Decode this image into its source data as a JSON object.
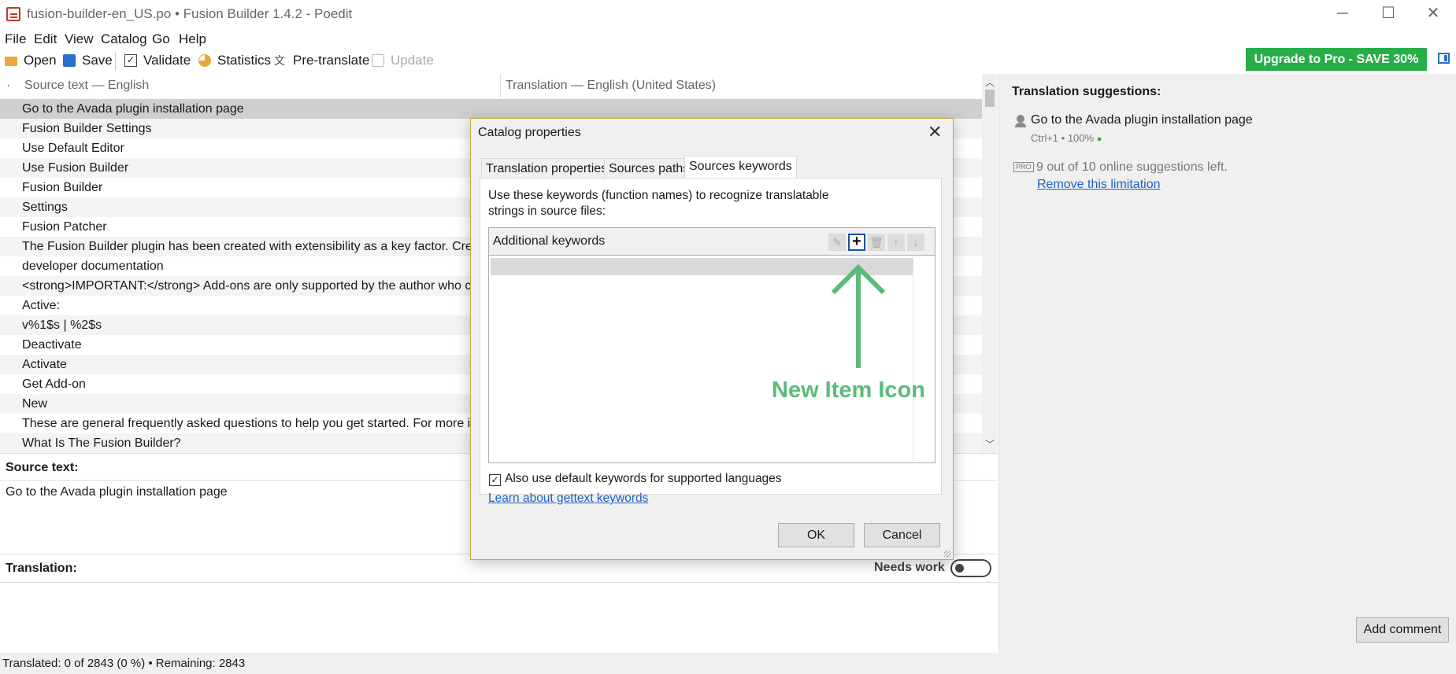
{
  "window": {
    "title": "fusion-builder-en_US.po • Fusion Builder 1.4.2 - Poedit",
    "minimize": "─",
    "maximize": "☐",
    "close": "✕"
  },
  "menu": [
    "File",
    "Edit",
    "View",
    "Catalog",
    "Go",
    "Help"
  ],
  "toolbar": {
    "open": "Open",
    "save": "Save",
    "validate": "Validate",
    "statistics": "Statistics",
    "pretranslate": "Pre-translate",
    "update": "Update",
    "upgrade": "Upgrade to Pro - SAVE 30%"
  },
  "list": {
    "dot": "·",
    "source_header": "Source text — English",
    "translation_header": "Translation — English (United States)",
    "rows": [
      "Go to the Avada plugin installation page",
      "Fusion Builder Settings",
      "Use Default Editor",
      "Use Fusion Builder",
      "Fusion Builder",
      "Settings",
      "Fusion Patcher",
      "The Fusion Builder plugin has been created with extensibility as a key factor. Creating A",
      "developer documentation",
      "<strong>IMPORTANT:</strong> Add-ons are only supported by the author who create",
      "Active:",
      "v%1$s | %2$s",
      "Deactivate",
      "Activate",
      "Get Add-on",
      "New",
      "These are general frequently asked questions to help you get started. For more in-dept",
      "What Is The Fusion Builder?"
    ]
  },
  "source_pane": {
    "label": "Source text:",
    "text": "Go to the Avada plugin installation page"
  },
  "translation_pane": {
    "label": "Translation:",
    "needs_work": "Needs work",
    "needs_work_on": false
  },
  "status": "Translated: 0 of 2843 (0 %)  •  Remaining: 2843",
  "sidebar": {
    "title": "Translation suggestions:",
    "suggestion": "Go to the Avada plugin installation page",
    "suggestion_meta": "Ctrl+1 • 100%",
    "pro_badge": "PRO",
    "suggestions_left": "9 out of 10 online suggestions left.",
    "remove_limit": "Remove this limitation",
    "add_comment": "Add comment"
  },
  "dialog": {
    "title": "Catalog properties",
    "close": "✕",
    "tabs": [
      "Translation properties",
      "Sources paths",
      "Sources keywords"
    ],
    "active_tab": 2,
    "intro": "Use these keywords (function names) to recognize translatable strings in source files:",
    "keywords_header": "Additional keywords",
    "tools": [
      "✎",
      "+",
      "🗑",
      "↑",
      "↓"
    ],
    "checkbox_label": "Also use default keywords for supported languages",
    "checkbox_checked": true,
    "learn_link": "Learn about gettext keywords",
    "ok": "OK",
    "cancel": "Cancel"
  },
  "annotation": {
    "text": "New Item Icon",
    "color": "#5cbb7b"
  },
  "colors": {
    "upgrade": "#27ae48",
    "link": "#1a63c4",
    "dialog_border": "#c9a642"
  }
}
